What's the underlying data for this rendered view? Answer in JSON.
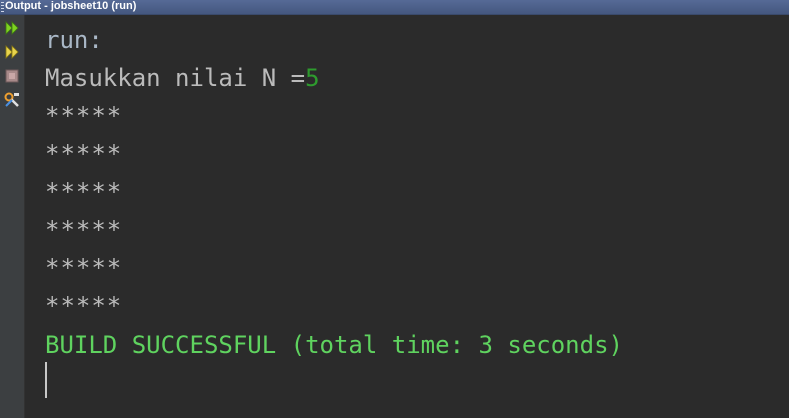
{
  "window": {
    "title": "Output - jobsheet10 (run)"
  },
  "toolbar": {
    "buttons": [
      {
        "icon": "rerun-icon",
        "tooltip": ""
      },
      {
        "icon": "rerun-with-params-icon",
        "tooltip": ""
      },
      {
        "icon": "stop-icon",
        "tooltip": ""
      },
      {
        "icon": "settings-icon",
        "tooltip": ""
      }
    ]
  },
  "console": {
    "run_label": "run:",
    "prompt": "Masukkan nilai N =",
    "input_value": "5",
    "star_rows": [
      "*****",
      "*****",
      "*****",
      "*****",
      "*****",
      "*****"
    ],
    "build_message": "BUILD SUCCESSFUL (total time: 3 seconds)"
  },
  "colors": {
    "background": "#2b2b2b",
    "text": "#bbbbbb",
    "input": "#2e9b2e",
    "success": "#5fd35f"
  }
}
